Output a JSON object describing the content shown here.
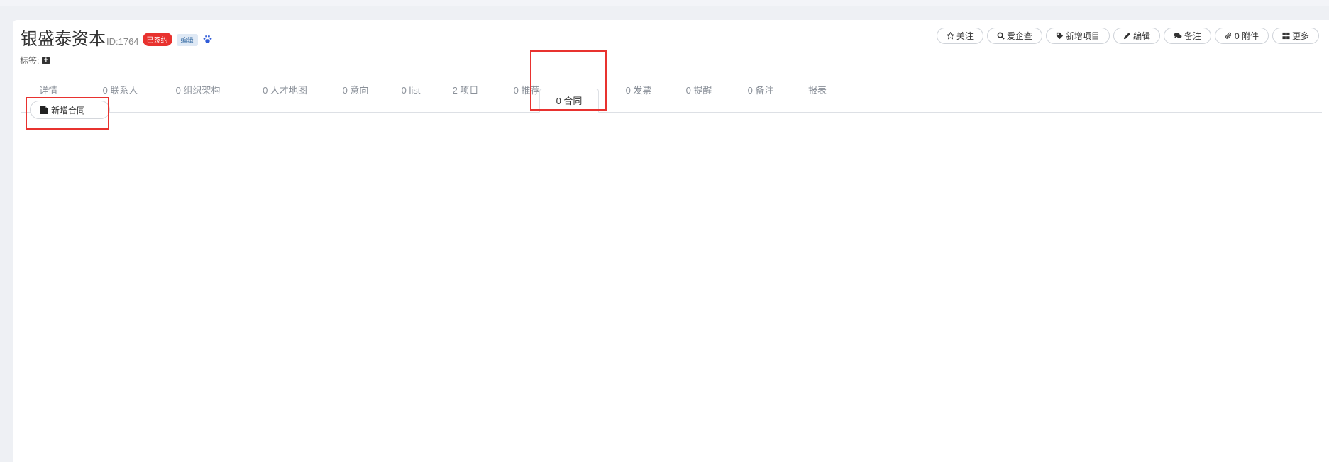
{
  "header": {
    "company_name": "银盛泰资本",
    "company_id": "ID:1764",
    "status_badge": "已签约",
    "edit_badge": "编辑",
    "tags_label": "标签:"
  },
  "actions": [
    {
      "label": "关注",
      "icon": "star-icon"
    },
    {
      "label": "爱企查",
      "icon": "search-icon"
    },
    {
      "label": "新增项目",
      "icon": "tag-icon"
    },
    {
      "label": "编辑",
      "icon": "pencil-icon"
    },
    {
      "label": "备注",
      "icon": "comments-icon"
    },
    {
      "label": "0 附件",
      "icon": "paperclip-icon"
    },
    {
      "label": "更多",
      "icon": "grid-icon"
    }
  ],
  "tabs": [
    {
      "label": "详情"
    },
    {
      "label": "0 联系人"
    },
    {
      "label": "0 组织架构"
    },
    {
      "label": "0 人才地图"
    },
    {
      "label": "0 意向"
    },
    {
      "label": "0 list"
    },
    {
      "label": "2 项目"
    },
    {
      "label": "0 推荐"
    },
    {
      "label": "0 合同",
      "active": true
    },
    {
      "label": "0 发票"
    },
    {
      "label": "0 提醒"
    },
    {
      "label": "0 备注"
    },
    {
      "label": "报表"
    }
  ],
  "content": {
    "new_contract_label": "新增合同"
  },
  "colors": {
    "accent_red": "#e8322f",
    "badge_blue": "#3a6ea5",
    "paw_blue": "#2f5bd8",
    "background": "#eef0f4"
  }
}
